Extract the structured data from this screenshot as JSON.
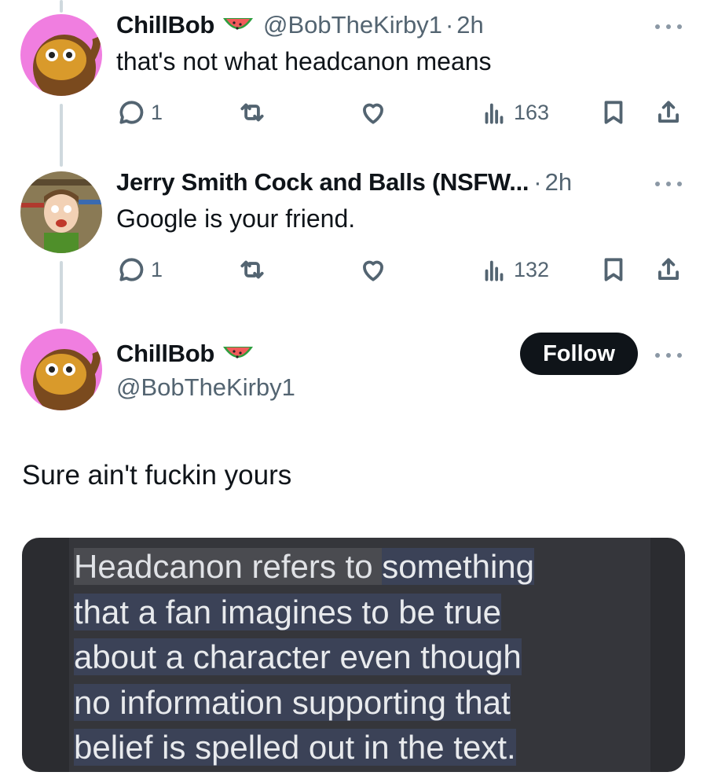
{
  "replies": [
    {
      "display_name": "ChillBob",
      "badge_icon": "watermelon-icon",
      "handle": "@BobTheKirby1",
      "separator": "·",
      "time": "2h",
      "text": "that's not what headcanon means",
      "replies_count": "1",
      "views": "163"
    },
    {
      "display_name": "Jerry Smith Cock and Balls (NSFW...",
      "separator": "·",
      "time": "2h",
      "text": "Google is your friend.",
      "replies_count": "1",
      "views": "132"
    }
  ],
  "main_tweet": {
    "display_name": "ChillBob",
    "badge_icon": "watermelon-icon",
    "handle": "@BobTheKirby1",
    "follow_label": "Follow",
    "text": "Sure ain't fuckin yours",
    "image_text": {
      "line1_plain": "Headcanon refers to ",
      "line1_highlight": "something",
      "line2": "that a fan imagines to be true",
      "line3": "about a character even though",
      "line4": "no information supporting that",
      "line5": "belief is spelled out in the text."
    }
  },
  "colors": {
    "text": "#0f1419",
    "secondary": "#536471",
    "thread_line": "#cfd9de",
    "follow_bg": "#0f1419",
    "avatar_pink": "#f07ee0"
  }
}
